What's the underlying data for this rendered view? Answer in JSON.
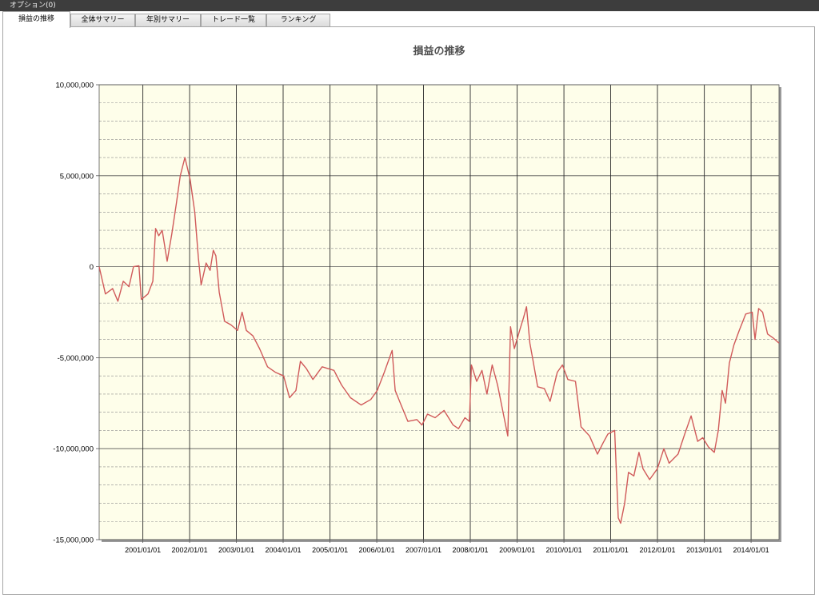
{
  "menubar": {
    "label": "オプション(0)"
  },
  "tabs": [
    {
      "label": "損益の推移",
      "active": true
    },
    {
      "label": "全体サマリー",
      "active": false
    },
    {
      "label": "年別サマリー",
      "active": false
    },
    {
      "label": "トレード一覧",
      "active": false
    },
    {
      "label": "ランキング",
      "active": false
    }
  ],
  "colors": {
    "plot_background": "#fefeea",
    "line": "#d05a5a",
    "menubar": "#3d3d3d"
  },
  "chart_data": {
    "type": "line",
    "title": "損益の推移",
    "xlabel": "",
    "ylabel": "",
    "x_domain": [
      "2000/01/26",
      "2014/08/07"
    ],
    "ylim": [
      -15000000,
      10000000
    ],
    "yticks": [
      10000000,
      5000000,
      0,
      -5000000,
      -10000000,
      -15000000
    ],
    "ytick_labels": [
      "10,000,000",
      "5,000,000",
      "0",
      "-5,000,000",
      "-10,000,000",
      "-15,000,000"
    ],
    "xticks": [
      "2001/01/01",
      "2002/01/01",
      "2003/01/01",
      "2004/01/01",
      "2005/01/01",
      "2006/01/01",
      "2007/01/01",
      "2008/01/01",
      "2009/01/01",
      "2010/01/01",
      "2011/01/01",
      "2012/01/01",
      "2013/01/01",
      "2014/01/01"
    ],
    "grid": true,
    "series": [
      {
        "color": "#d05a5a",
        "points": [
          [
            "2000/01/26",
            0
          ],
          [
            "2000/03/15",
            -1500000
          ],
          [
            "2000/05/10",
            -1200000
          ],
          [
            "2000/06/20",
            -1900000
          ],
          [
            "2000/08/01",
            -800000
          ],
          [
            "2000/09/15",
            -1100000
          ],
          [
            "2000/10/20",
            0
          ],
          [
            "2000/12/01",
            50000
          ],
          [
            "2000/12/20",
            -1800000
          ],
          [
            "2001/02/10",
            -1500000
          ],
          [
            "2001/03/20",
            -800000
          ],
          [
            "2001/04/10",
            2100000
          ],
          [
            "2001/05/05",
            1700000
          ],
          [
            "2001/06/01",
            2000000
          ],
          [
            "2001/07/10",
            300000
          ],
          [
            "2001/08/15",
            1800000
          ],
          [
            "2001/09/20",
            3500000
          ],
          [
            "2001/10/20",
            5000000
          ],
          [
            "2001/11/25",
            6000000
          ],
          [
            "2002/01/05",
            4800000
          ],
          [
            "2002/02/10",
            3000000
          ],
          [
            "2002/03/10",
            500000
          ],
          [
            "2002/04/01",
            -1000000
          ],
          [
            "2002/05/10",
            200000
          ],
          [
            "2002/06/10",
            -200000
          ],
          [
            "2002/07/05",
            900000
          ],
          [
            "2002/07/25",
            600000
          ],
          [
            "2002/08/20",
            -1400000
          ],
          [
            "2002/10/01",
            -3000000
          ],
          [
            "2002/11/20",
            -3200000
          ],
          [
            "2003/01/10",
            -3500000
          ],
          [
            "2003/02/15",
            -2500000
          ],
          [
            "2003/03/20",
            -3500000
          ],
          [
            "2003/05/10",
            -3800000
          ],
          [
            "2003/07/01",
            -4500000
          ],
          [
            "2003/09/01",
            -5500000
          ],
          [
            "2003/11/01",
            -5800000
          ],
          [
            "2004/01/05",
            -6000000
          ],
          [
            "2004/02/20",
            -7200000
          ],
          [
            "2004/04/10",
            -6800000
          ],
          [
            "2004/05/15",
            -5200000
          ],
          [
            "2004/07/01",
            -5600000
          ],
          [
            "2004/08/20",
            -6200000
          ],
          [
            "2004/11/01",
            -5500000
          ],
          [
            "2005/02/01",
            -5700000
          ],
          [
            "2005/04/01",
            -6500000
          ],
          [
            "2005/06/10",
            -7200000
          ],
          [
            "2005/09/01",
            -7600000
          ],
          [
            "2005/11/15",
            -7300000
          ],
          [
            "2006/01/05",
            -6800000
          ],
          [
            "2006/03/01",
            -5800000
          ],
          [
            "2006/05/01",
            -4600000
          ],
          [
            "2006/05/25",
            -6800000
          ],
          [
            "2006/07/10",
            -7600000
          ],
          [
            "2006/09/01",
            -8500000
          ],
          [
            "2006/11/10",
            -8400000
          ],
          [
            "2006/12/20",
            -8700000
          ],
          [
            "2007/02/01",
            -8100000
          ],
          [
            "2007/04/01",
            -8300000
          ],
          [
            "2007/06/10",
            -7900000
          ],
          [
            "2007/08/20",
            -8700000
          ],
          [
            "2007/10/01",
            -8900000
          ],
          [
            "2007/11/20",
            -8300000
          ],
          [
            "2007/12/25",
            -8500000
          ],
          [
            "2008/01/10",
            -5400000
          ],
          [
            "2008/02/20",
            -6300000
          ],
          [
            "2008/04/01",
            -5700000
          ],
          [
            "2008/05/10",
            -7000000
          ],
          [
            "2008/06/20",
            -5400000
          ],
          [
            "2008/08/01",
            -6500000
          ],
          [
            "2008/09/10",
            -7900000
          ],
          [
            "2008/10/20",
            -9300000
          ],
          [
            "2008/11/10",
            -3300000
          ],
          [
            "2008/12/10",
            -4500000
          ],
          [
            "2009/01/20",
            -3500000
          ],
          [
            "2009/02/20",
            -2800000
          ],
          [
            "2009/03/15",
            -2200000
          ],
          [
            "2009/04/10",
            -4200000
          ],
          [
            "2009/05/01",
            -5000000
          ],
          [
            "2009/06/10",
            -6600000
          ],
          [
            "2009/08/01",
            -6700000
          ],
          [
            "2009/09/15",
            -7400000
          ],
          [
            "2009/11/10",
            -5800000
          ],
          [
            "2009/12/20",
            -5400000
          ],
          [
            "2010/02/01",
            -6200000
          ],
          [
            "2010/04/01",
            -6300000
          ],
          [
            "2010/05/15",
            -8800000
          ],
          [
            "2010/07/20",
            -9300000
          ],
          [
            "2010/09/20",
            -10300000
          ],
          [
            "2010/11/01",
            -9700000
          ],
          [
            "2010/12/10",
            -9200000
          ],
          [
            "2011/02/01",
            -9000000
          ],
          [
            "2011/03/01",
            -13800000
          ],
          [
            "2011/03/20",
            -14100000
          ],
          [
            "2011/04/20",
            -13000000
          ],
          [
            "2011/05/20",
            -11300000
          ],
          [
            "2011/07/01",
            -11500000
          ],
          [
            "2011/08/10",
            -10200000
          ],
          [
            "2011/09/10",
            -11100000
          ],
          [
            "2011/11/01",
            -11700000
          ],
          [
            "2012/01/01",
            -11100000
          ],
          [
            "2012/02/20",
            -10000000
          ],
          [
            "2012/04/01",
            -10800000
          ],
          [
            "2012/06/10",
            -10300000
          ],
          [
            "2012/08/01",
            -9200000
          ],
          [
            "2012/09/20",
            -8200000
          ],
          [
            "2012/11/10",
            -9600000
          ],
          [
            "2012/12/20",
            -9400000
          ],
          [
            "2013/02/01",
            -9900000
          ],
          [
            "2013/03/20",
            -10200000
          ],
          [
            "2013/04/20",
            -9000000
          ],
          [
            "2013/05/20",
            -6800000
          ],
          [
            "2013/06/15",
            -7500000
          ],
          [
            "2013/07/15",
            -5300000
          ],
          [
            "2013/08/20",
            -4300000
          ],
          [
            "2013/10/01",
            -3500000
          ],
          [
            "2013/11/20",
            -2600000
          ],
          [
            "2014/01/10",
            -2500000
          ],
          [
            "2014/02/01",
            -4000000
          ],
          [
            "2014/03/01",
            -2300000
          ],
          [
            "2014/04/01",
            -2500000
          ],
          [
            "2014/05/10",
            -3700000
          ],
          [
            "2014/06/20",
            -3900000
          ],
          [
            "2014/08/07",
            -4200000
          ]
        ]
      }
    ]
  }
}
